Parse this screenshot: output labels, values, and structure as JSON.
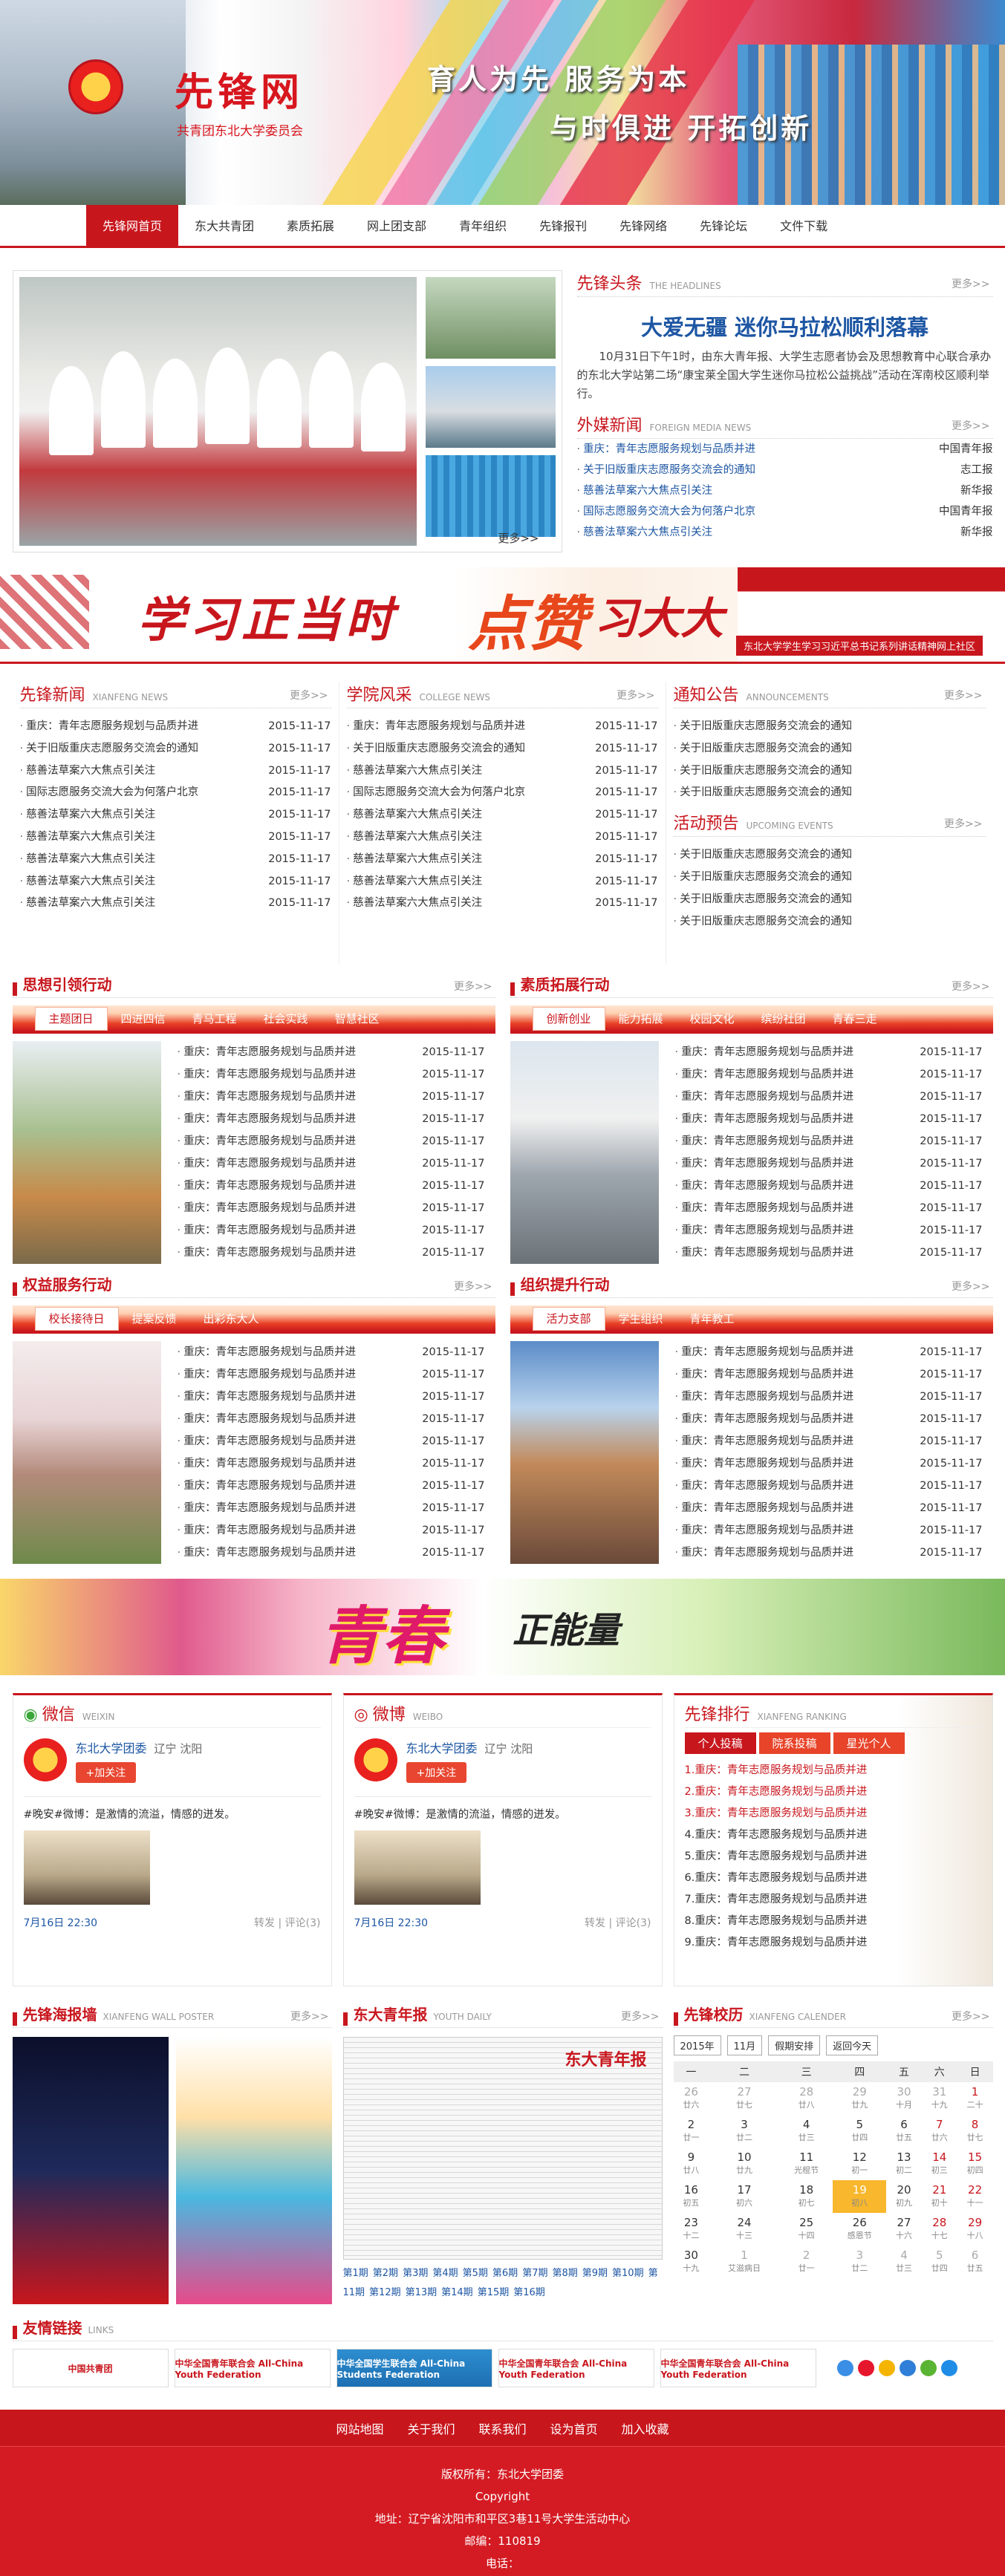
{
  "header": {
    "site_title": "先锋网",
    "site_sub": "共青团东北大学委员会",
    "slogan1": "育人为先  服务为本",
    "slogan2": "与时俱进  开拓创新"
  },
  "nav": [
    "先锋网首页",
    "东大共青团",
    "素质拓展",
    "网上团支部",
    "青年组织",
    "先锋报刊",
    "先锋网络",
    "先锋论坛",
    "文件下载"
  ],
  "slider": {
    "more": "更多>>"
  },
  "headlines": {
    "title_cn": "先锋头条",
    "title_en": "THE HEADLINES",
    "more": "更多>>",
    "headline": "大爱无疆 迷你马拉松顺利落幕",
    "body": "10月31日下午1时，由东大青年报、大学生志愿者协会及思想教育中心联合承办的东北大学站第二场“康宝莱全国大学生迷你马拉松公益挑战”活动在浑南校区顺利举行。"
  },
  "foreign": {
    "title_cn": "外媒新闻",
    "title_en": "FOREIGN MEDIA NEWS",
    "more": "更多>>",
    "items": [
      {
        "t": "重庆：青年志愿服务规划与品质并进",
        "s": "中国青年报"
      },
      {
        "t": "关于旧版重庆志愿服务交流会的通知",
        "s": "志工报"
      },
      {
        "t": "慈善法草案六大焦点引关注",
        "s": "新华报"
      },
      {
        "t": "国际志愿服务交流大会为何落户北京",
        "s": "中国青年报"
      },
      {
        "t": "慈善法草案六大焦点引关注",
        "s": "新华报"
      }
    ]
  },
  "banner1": {
    "t1": "学习正当时",
    "t2": "点赞",
    "t3": "习大大",
    "cap": "东北大学学生学习习近平总书记系列讲话精神网上社区"
  },
  "xianfeng_news": {
    "title_cn": "先锋新闻",
    "title_en": "XIANFENG NEWS",
    "more": "更多>>",
    "items": [
      {
        "t": "重庆：青年志愿服务规划与品质并进",
        "d": "2015-11-17"
      },
      {
        "t": "关于旧版重庆志愿服务交流会的通知",
        "d": "2015-11-17"
      },
      {
        "t": "慈善法草案六大焦点引关注",
        "d": "2015-11-17"
      },
      {
        "t": "国际志愿服务交流大会为何落户北京",
        "d": "2015-11-17"
      },
      {
        "t": "慈善法草案六大焦点引关注",
        "d": "2015-11-17"
      },
      {
        "t": "慈善法草案六大焦点引关注",
        "d": "2015-11-17"
      },
      {
        "t": "慈善法草案六大焦点引关注",
        "d": "2015-11-17"
      },
      {
        "t": "慈善法草案六大焦点引关注",
        "d": "2015-11-17"
      },
      {
        "t": "慈善法草案六大焦点引关注",
        "d": "2015-11-17"
      }
    ]
  },
  "college_news": {
    "title_cn": "学院风采",
    "title_en": "COLLEGE NEWS",
    "more": "更多>>",
    "items": [
      {
        "t": "重庆：青年志愿服务规划与品质并进",
        "d": "2015-11-17"
      },
      {
        "t": "关于旧版重庆志愿服务交流会的通知",
        "d": "2015-11-17"
      },
      {
        "t": "慈善法草案六大焦点引关注",
        "d": "2015-11-17"
      },
      {
        "t": "国际志愿服务交流大会为何落户北京",
        "d": "2015-11-17"
      },
      {
        "t": "慈善法草案六大焦点引关注",
        "d": "2015-11-17"
      },
      {
        "t": "慈善法草案六大焦点引关注",
        "d": "2015-11-17"
      },
      {
        "t": "慈善法草案六大焦点引关注",
        "d": "2015-11-17"
      },
      {
        "t": "慈善法草案六大焦点引关注",
        "d": "2015-11-17"
      },
      {
        "t": "慈善法草案六大焦点引关注",
        "d": "2015-11-17"
      }
    ]
  },
  "announcements": {
    "title_cn": "通知公告",
    "title_en": "ANNOUNCEMENTS",
    "more": "更多>>",
    "items": [
      "关于旧版重庆志愿服务交流会的通知",
      "关于旧版重庆志愿服务交流会的通知",
      "关于旧版重庆志愿服务交流会的通知",
      "关于旧版重庆志愿服务交流会的通知"
    ]
  },
  "upcoming": {
    "title_cn": "活动预告",
    "title_en": "UPCOMING EVENTS",
    "more": "更多>>",
    "items": [
      "关于旧版重庆志愿服务交流会的通知",
      "关于旧版重庆志愿服务交流会的通知",
      "关于旧版重庆志愿服务交流会的通知",
      "关于旧版重庆志愿服务交流会的通知"
    ]
  },
  "sec_thought": {
    "title": "思想引领行动",
    "more": "更多>>",
    "tabs": [
      "主题团日",
      "四进四信",
      "青马工程",
      "社会实践",
      "智慧社区"
    ]
  },
  "sec_quality": {
    "title": "素质拓展行动",
    "more": "更多>>",
    "tabs": [
      "创新创业",
      "能力拓展",
      "校园文化",
      "缤纷社团",
      "青春三走"
    ]
  },
  "sec_rights": {
    "title": "权益服务行动",
    "more": "更多>>",
    "tabs": [
      "校长接待日",
      "提案反馈",
      "出彩东大人"
    ]
  },
  "sec_org": {
    "title": "组织提升行动",
    "more": "更多>>",
    "tabs": [
      "活力支部",
      "学生组织",
      "青年教工"
    ]
  },
  "tab_news": [
    {
      "t": "重庆：青年志愿服务规划与品质并进",
      "d": "2015-11-17"
    },
    {
      "t": "重庆：青年志愿服务规划与品质并进",
      "d": "2015-11-17"
    },
    {
      "t": "重庆：青年志愿服务规划与品质并进",
      "d": "2015-11-17"
    },
    {
      "t": "重庆：青年志愿服务规划与品质并进",
      "d": "2015-11-17"
    },
    {
      "t": "重庆：青年志愿服务规划与品质并进",
      "d": "2015-11-17"
    },
    {
      "t": "重庆：青年志愿服务规划与品质并进",
      "d": "2015-11-17"
    },
    {
      "t": "重庆：青年志愿服务规划与品质并进",
      "d": "2015-11-17"
    },
    {
      "t": "重庆：青年志愿服务规划与品质并进",
      "d": "2015-11-17"
    },
    {
      "t": "重庆：青年志愿服务规划与品质并进",
      "d": "2015-11-17"
    },
    {
      "t": "重庆：青年志愿服务规划与品质并进",
      "d": "2015-11-17"
    }
  ],
  "banner2": {
    "t1": "青春",
    "t2": "正能量"
  },
  "weixin": {
    "title_cn": "微信",
    "title_en": "WEIXIN",
    "name": "东北大学团委",
    "loc": "辽宁  沈阳",
    "follow": "+加关注",
    "post": "#晚安#微博：是激情的流溢，情感的迸发。",
    "date": "7月16日 22:30",
    "repost": "转发",
    "comment": "评论(3)"
  },
  "weibo": {
    "title_cn": "微博",
    "title_en": "WEIBO",
    "name": "东北大学团委",
    "loc": "辽宁  沈阳",
    "follow": "+加关注",
    "post": "#晚安#微博：是激情的流溢，情感的迸发。",
    "date": "7月16日 22:30",
    "repost": "转发",
    "comment": "评论(3)"
  },
  "ranking": {
    "title_cn": "先锋排行",
    "title_en": "XIANFENG RANKING",
    "tabs": [
      "个人投稿",
      "院系投稿",
      "星光个人"
    ],
    "items": [
      "1.重庆：青年志愿服务规划与品质并进",
      "2.重庆：青年志愿服务规划与品质并进",
      "3.重庆：青年志愿服务规划与品质并进",
      "4.重庆：青年志愿服务规划与品质并进",
      "5.重庆：青年志愿服务规划与品质并进",
      "6.重庆：青年志愿服务规划与品质并进",
      "7.重庆：青年志愿服务规划与品质并进",
      "8.重庆：青年志愿服务规划与品质并进",
      "9.重庆：青年志愿服务规划与品质并进"
    ]
  },
  "poster": {
    "title_cn": "先锋海报墙",
    "title_en": "XIANFENG WALL POSTER",
    "more": "更多>>"
  },
  "youth_daily": {
    "title_cn": "东大青年报",
    "title_en": "YOUTH DAILY",
    "more": "更多>>",
    "paper_title": "东大青年报",
    "pages": [
      "第1期",
      "第2期",
      "第3期",
      "第4期",
      "第5期",
      "第6期",
      "第7期",
      "第8期",
      "第9期",
      "第10期",
      "第11期",
      "第12期",
      "第13期",
      "第14期",
      "第15期",
      "第16期"
    ]
  },
  "calendar": {
    "title_cn": "先锋校历",
    "title_en": "XIANFENG CALENDER",
    "more": "更多>>",
    "year": "2015年",
    "month": "11月",
    "holiday": "假期安排",
    "today_btn": "返回今天",
    "weekdays": [
      "一",
      "二",
      "三",
      "四",
      "五",
      "六",
      "日"
    ],
    "weeks": [
      [
        [
          "26",
          "廿六"
        ],
        [
          "27",
          "廿七"
        ],
        [
          "28",
          "廿八"
        ],
        [
          "29",
          "廿九"
        ],
        [
          "30",
          "十月"
        ],
        [
          "31",
          "十九"
        ],
        [
          "1",
          "二十"
        ]
      ],
      [
        [
          "2",
          "廿一"
        ],
        [
          "3",
          "廿二"
        ],
        [
          "4",
          "廿三"
        ],
        [
          "5",
          "廿四"
        ],
        [
          "6",
          "廿五"
        ],
        [
          "7",
          "廿六"
        ],
        [
          "8",
          "廿七"
        ]
      ],
      [
        [
          "9",
          "廿八"
        ],
        [
          "10",
          "廿九"
        ],
        [
          "11",
          "光棍节"
        ],
        [
          "12",
          "初一"
        ],
        [
          "13",
          "初二"
        ],
        [
          "14",
          "初三"
        ],
        [
          "15",
          "初四"
        ]
      ],
      [
        [
          "16",
          "初五"
        ],
        [
          "17",
          "初六"
        ],
        [
          "18",
          "初七"
        ],
        [
          "19",
          "初八"
        ],
        [
          "20",
          "初九"
        ],
        [
          "21",
          "初十"
        ],
        [
          "22",
          "十一"
        ]
      ],
      [
        [
          "23",
          "十二"
        ],
        [
          "24",
          "十三"
        ],
        [
          "25",
          "十四"
        ],
        [
          "26",
          "感恩节"
        ],
        [
          "27",
          "十六"
        ],
        [
          "28",
          "十七"
        ],
        [
          "29",
          "十八"
        ]
      ],
      [
        [
          "30",
          "十九"
        ],
        [
          "1",
          "艾滋病日"
        ],
        [
          "2",
          "廿一"
        ],
        [
          "3",
          "廿二"
        ],
        [
          "4",
          "廿三"
        ],
        [
          "5",
          "廿四"
        ],
        [
          "6",
          "廿五"
        ]
      ]
    ]
  },
  "links": {
    "title_cn": "友情链接",
    "title_en": "LINKS",
    "items": [
      "中国共青团",
      "中华全国青年联合会 All-China Youth Federation",
      "中华全国学生联合会 All-China Students Federation",
      "中华全国青年联合会 All-China Youth Federation",
      "中华全国青年联合会 All-China Youth Federation"
    ]
  },
  "footer_nav": [
    "网站地图",
    "关于我们",
    "联系我们",
    "设为首页",
    "加入收藏"
  ],
  "footer": {
    "copyright": "版权所有：东北大学团委",
    "copy_en": "Copyright",
    "address": "地址：辽宁省沈阳市和平区3巷11号大学生活动中心",
    "zip": "邮编：110819",
    "phone": "电话："
  }
}
